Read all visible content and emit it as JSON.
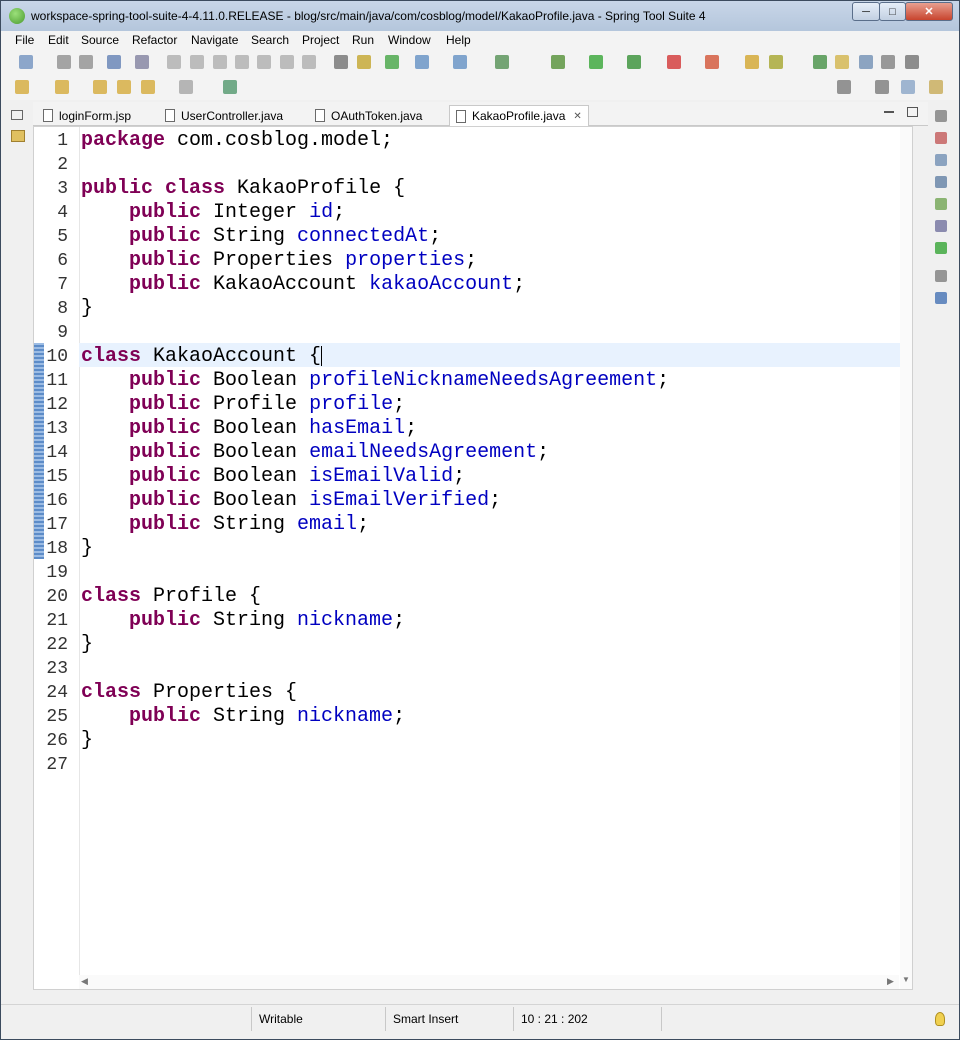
{
  "window": {
    "title": "workspace-spring-tool-suite-4-4.11.0.RELEASE - blog/src/main/java/com/cosblog/model/KakaoProfile.java - Spring Tool Suite 4",
    "minimize": "─",
    "maximize": "□",
    "close": "✕"
  },
  "menu": [
    "File",
    "Edit",
    "Source",
    "Refactor",
    "Navigate",
    "Search",
    "Project",
    "Run",
    "Window",
    "Help"
  ],
  "tabs": [
    {
      "label": "loginForm.jsp"
    },
    {
      "label": "UserController.java"
    },
    {
      "label": "OAuthToken.java"
    },
    {
      "label": "KakaoProfile.java",
      "active": true
    }
  ],
  "tab_close": "✕",
  "code": [
    {
      "n": "1",
      "t": [
        [
          "kw",
          "package"
        ],
        [
          "p",
          " com.cosblog.model;"
        ]
      ]
    },
    {
      "n": "2",
      "t": []
    },
    {
      "n": "3",
      "t": [
        [
          "kw",
          "public"
        ],
        [
          "p",
          " "
        ],
        [
          "kw",
          "class"
        ],
        [
          "p",
          " KakaoProfile {"
        ]
      ]
    },
    {
      "n": "4",
      "t": [
        [
          "p",
          "    "
        ],
        [
          "kw",
          "public"
        ],
        [
          "p",
          " Integer "
        ],
        [
          "fld",
          "id"
        ],
        [
          "p",
          ";"
        ]
      ]
    },
    {
      "n": "5",
      "t": [
        [
          "p",
          "    "
        ],
        [
          "kw",
          "public"
        ],
        [
          "p",
          " String "
        ],
        [
          "fld",
          "connectedAt"
        ],
        [
          "p",
          ";"
        ]
      ]
    },
    {
      "n": "6",
      "t": [
        [
          "p",
          "    "
        ],
        [
          "kw",
          "public"
        ],
        [
          "p",
          " Properties "
        ],
        [
          "fld",
          "properties"
        ],
        [
          "p",
          ";"
        ]
      ]
    },
    {
      "n": "7",
      "t": [
        [
          "p",
          "    "
        ],
        [
          "kw",
          "public"
        ],
        [
          "p",
          " KakaoAccount "
        ],
        [
          "fld",
          "kakaoAccount"
        ],
        [
          "p",
          ";"
        ]
      ]
    },
    {
      "n": "8",
      "t": [
        [
          "p",
          "}"
        ]
      ]
    },
    {
      "n": "9",
      "t": []
    },
    {
      "n": "10",
      "t": [
        [
          "kw",
          "class"
        ],
        [
          "p",
          " KakaoAccount {"
        ]
      ]
    },
    {
      "n": "11",
      "t": [
        [
          "p",
          "    "
        ],
        [
          "kw",
          "public"
        ],
        [
          "p",
          " Boolean "
        ],
        [
          "fld",
          "profileNicknameNeedsAgreement"
        ],
        [
          "p",
          ";"
        ]
      ]
    },
    {
      "n": "12",
      "t": [
        [
          "p",
          "    "
        ],
        [
          "kw",
          "public"
        ],
        [
          "p",
          " Profile "
        ],
        [
          "fld",
          "profile"
        ],
        [
          "p",
          ";"
        ]
      ]
    },
    {
      "n": "13",
      "t": [
        [
          "p",
          "    "
        ],
        [
          "kw",
          "public"
        ],
        [
          "p",
          " Boolean "
        ],
        [
          "fld",
          "hasEmail"
        ],
        [
          "p",
          ";"
        ]
      ]
    },
    {
      "n": "14",
      "t": [
        [
          "p",
          "    "
        ],
        [
          "kw",
          "public"
        ],
        [
          "p",
          " Boolean "
        ],
        [
          "fld",
          "emailNeedsAgreement"
        ],
        [
          "p",
          ";"
        ]
      ]
    },
    {
      "n": "15",
      "t": [
        [
          "p",
          "    "
        ],
        [
          "kw",
          "public"
        ],
        [
          "p",
          " Boolean "
        ],
        [
          "fld",
          "isEmailValid"
        ],
        [
          "p",
          ";"
        ]
      ]
    },
    {
      "n": "16",
      "t": [
        [
          "p",
          "    "
        ],
        [
          "kw",
          "public"
        ],
        [
          "p",
          " Boolean "
        ],
        [
          "fld",
          "isEmailVerified"
        ],
        [
          "p",
          ";"
        ]
      ]
    },
    {
      "n": "17",
      "t": [
        [
          "p",
          "    "
        ],
        [
          "kw",
          "public"
        ],
        [
          "p",
          " String "
        ],
        [
          "fld",
          "email"
        ],
        [
          "p",
          ";"
        ]
      ]
    },
    {
      "n": "18",
      "t": [
        [
          "p",
          "}"
        ]
      ]
    },
    {
      "n": "19",
      "t": []
    },
    {
      "n": "20",
      "t": [
        [
          "kw",
          "class"
        ],
        [
          "p",
          " Profile {"
        ]
      ]
    },
    {
      "n": "21",
      "t": [
        [
          "p",
          "    "
        ],
        [
          "kw",
          "public"
        ],
        [
          "p",
          " String "
        ],
        [
          "fld",
          "nickname"
        ],
        [
          "p",
          ";"
        ]
      ]
    },
    {
      "n": "22",
      "t": [
        [
          "p",
          "}"
        ]
      ]
    },
    {
      "n": "23",
      "t": []
    },
    {
      "n": "24",
      "t": [
        [
          "kw",
          "class"
        ],
        [
          "p",
          " Properties {"
        ]
      ]
    },
    {
      "n": "25",
      "t": [
        [
          "p",
          "    "
        ],
        [
          "kw",
          "public"
        ],
        [
          "p",
          " String "
        ],
        [
          "fld",
          "nickname"
        ],
        [
          "p",
          ";"
        ]
      ]
    },
    {
      "n": "26",
      "t": [
        [
          "p",
          "}"
        ]
      ]
    },
    {
      "n": "27",
      "t": []
    }
  ],
  "status": {
    "writable": "Writable",
    "insert_mode": "Smart Insert",
    "position": "10 : 21 : 202"
  },
  "colors": {
    "keyword": "#7f0055",
    "field": "#0000c0",
    "current_line": "#e8f2fe"
  }
}
